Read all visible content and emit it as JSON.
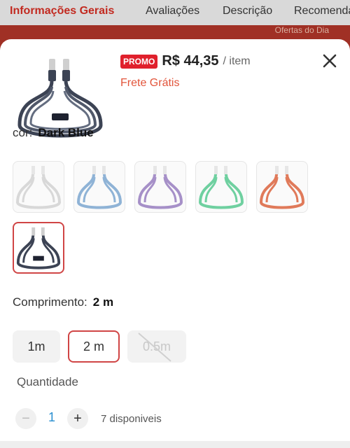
{
  "background": {
    "tabs": [
      {
        "label": "Informações Gerais",
        "active": true
      },
      {
        "label": "Avaliações",
        "active": false
      },
      {
        "label": "Descrição",
        "active": false
      },
      {
        "label": "Recomenda",
        "active": false
      }
    ],
    "banner_text": "Ofertas do Dia"
  },
  "product": {
    "badge": "PROMO",
    "price": "R$ 44,35",
    "unit": "/ item",
    "shipping": "Frete Grátis",
    "thumb_icon": "usb-cable-image"
  },
  "color": {
    "label": "cor:",
    "selected": "Dark Blue",
    "swatches": [
      {
        "name": "White",
        "hex": "#d8d8d8"
      },
      {
        "name": "Blue",
        "hex": "#8fb3d6"
      },
      {
        "name": "Purple",
        "hex": "#a690c8"
      },
      {
        "name": "Green",
        "hex": "#6fd0a0"
      },
      {
        "name": "Orange",
        "hex": "#e07a5a"
      },
      {
        "name": "Dark Blue",
        "hex": "#3c4354"
      }
    ]
  },
  "length": {
    "label": "Comprimento:",
    "selected": "2 m",
    "options": [
      {
        "label": "1m",
        "state": "available"
      },
      {
        "label": "2 m",
        "state": "selected"
      },
      {
        "label": "0.5m",
        "state": "unavailable"
      }
    ]
  },
  "quantity": {
    "label": "Quantidade",
    "value": "1",
    "minus": "−",
    "plus": "+",
    "stock": "7 disponiveis"
  },
  "colors": {
    "accent": "#e0202c",
    "shipping": "#e2543a",
    "selected_border": "#d04545"
  }
}
